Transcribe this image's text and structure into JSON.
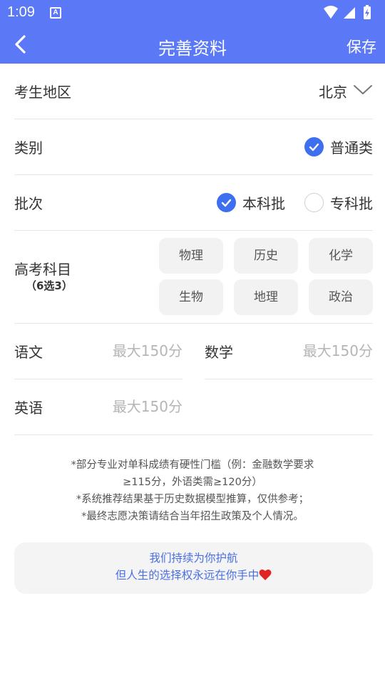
{
  "status_bar": {
    "time": "1:09",
    "app_icon_letter": "A"
  },
  "nav": {
    "title": "完善资料",
    "save_label": "保存"
  },
  "region": {
    "label": "考生地区",
    "value": "北京"
  },
  "category": {
    "label": "类别",
    "option": "普通类",
    "selected": true
  },
  "batch": {
    "label": "批次",
    "options": [
      {
        "label": "本科批",
        "selected": true
      },
      {
        "label": "专科批",
        "selected": false
      }
    ]
  },
  "subjects": {
    "label": "高考科目",
    "sub_label": "（6选3）",
    "items": [
      "物理",
      "历史",
      "化学",
      "生物",
      "地理",
      "政治"
    ]
  },
  "scores": {
    "chinese": {
      "label": "语文",
      "placeholder": "最大150分"
    },
    "math": {
      "label": "数学",
      "placeholder": "最大150分"
    },
    "english": {
      "label": "英语",
      "placeholder": "最大150分"
    }
  },
  "notes": [
    "*部分专业对单科成绩有硬性门槛（例：金融数学要求≥115分，外语类需≥120分）",
    "*系统推荐结果基于历史数据模型推算，仅供参考；",
    "*最终志愿决策请结合当年招生政策及个人情况。"
  ],
  "banner": {
    "line1": "我们持续为你护航",
    "line2": "但人生的选择权永远在你手中"
  },
  "colors": {
    "primary": "#5b78f6",
    "radio_on": "#3f6ff1",
    "banner_text": "#4a6fe3",
    "heart": "#e02424"
  }
}
